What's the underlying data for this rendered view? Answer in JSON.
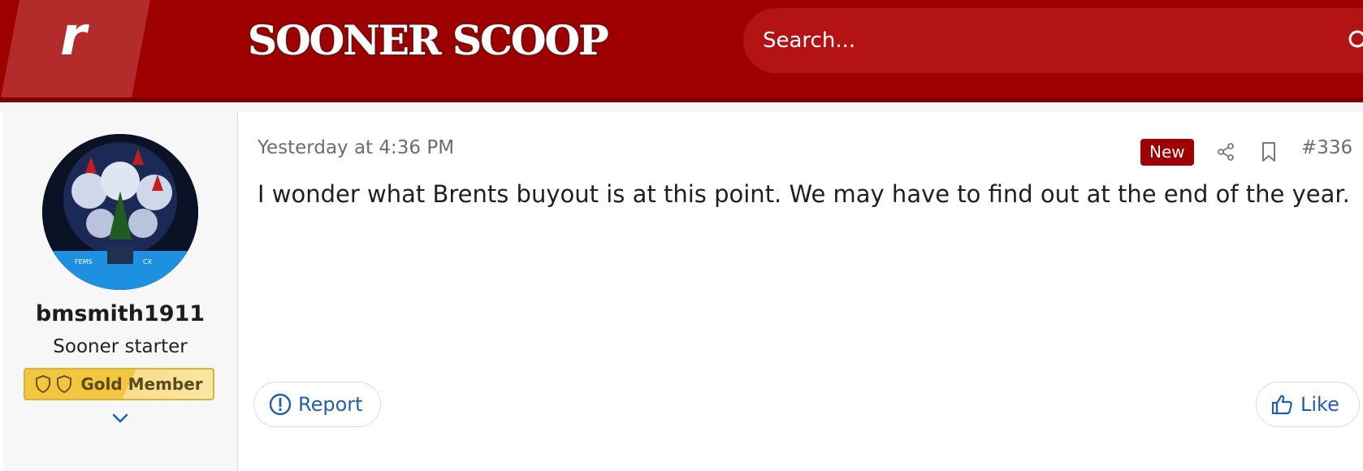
{
  "header": {
    "logo_letter": "r",
    "brand": "SOONER SCOOP",
    "search": {
      "placeholder": "Search..."
    }
  },
  "post": {
    "user": {
      "username": "bmsmith1911",
      "user_title": "Sooner starter",
      "badge": "Gold Member",
      "avatar_label": "user avatar"
    },
    "timestamp": "Yesterday at 4:36 PM",
    "new_label": "New",
    "post_number": "#336",
    "message": "I wonder what Brents buyout is at this point. We may have to find out at the end of the year.",
    "actions": {
      "report": "Report",
      "like": "Like"
    }
  },
  "icons": [
    "search-icon",
    "shield-icon",
    "chevron-down-icon",
    "share-icon",
    "bookmark-icon",
    "report-icon",
    "thumbs-up-icon"
  ],
  "colors": {
    "header_red": "#9e0000",
    "search_red": "#b31313",
    "new_badge": "#9c0000",
    "link_blue": "#1f5fae",
    "gold": "#f3c640"
  }
}
